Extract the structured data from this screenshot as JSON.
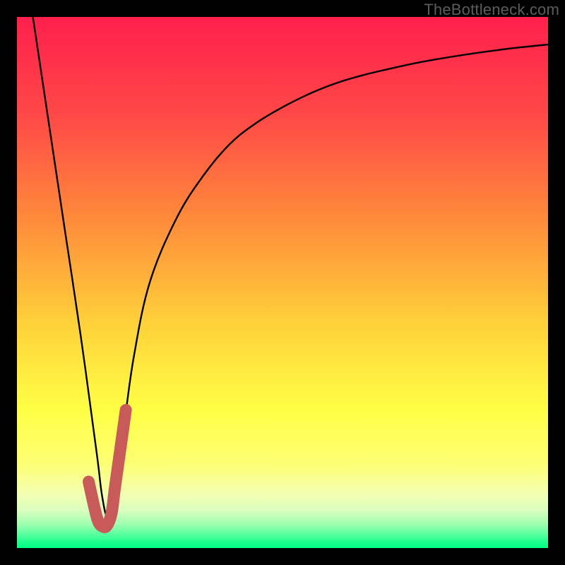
{
  "watermark": "TheBottleneck.com",
  "chart_data": {
    "type": "line",
    "title": "",
    "xlabel": "",
    "ylabel": "",
    "xlim": [
      0,
      100
    ],
    "ylim": [
      0,
      100
    ],
    "grid": false,
    "legend": false,
    "series": [
      {
        "name": "bottleneck-curve",
        "color": "#000000",
        "x": [
          3,
          6,
          9,
          12,
          15,
          16,
          17,
          18,
          20,
          22,
          25,
          30,
          35,
          40,
          45,
          50,
          55,
          60,
          65,
          70,
          75,
          80,
          85,
          90,
          95,
          100
        ],
        "y": [
          100,
          80,
          60,
          40,
          18,
          10,
          6,
          10,
          22,
          36,
          50,
          62,
          70,
          76,
          80,
          83,
          85.5,
          87.5,
          89,
          90.2,
          91.3,
          92.2,
          93,
          93.7,
          94.3,
          94.8
        ]
      },
      {
        "name": "highlight-segment",
        "color": "#c85a5a",
        "x": [
          13.5,
          14.5,
          15.3,
          16.2,
          17.0,
          17.8,
          18.4,
          19.1,
          19.8,
          20.5
        ],
        "y": [
          12.5,
          8.0,
          5.0,
          4.0,
          4.3,
          6.5,
          11,
          16,
          21,
          26
        ]
      }
    ],
    "background_gradient": {
      "direction": "vertical",
      "stops": [
        {
          "offset": 0.0,
          "color": "#ff1f4c"
        },
        {
          "offset": 0.18,
          "color": "#ff4747"
        },
        {
          "offset": 0.38,
          "color": "#ff8a3a"
        },
        {
          "offset": 0.58,
          "color": "#ffd23a"
        },
        {
          "offset": 0.74,
          "color": "#ffff45"
        },
        {
          "offset": 0.84,
          "color": "#fdff72"
        },
        {
          "offset": 0.9,
          "color": "#f3ffb3"
        },
        {
          "offset": 0.93,
          "color": "#d9ffbf"
        },
        {
          "offset": 0.955,
          "color": "#9fffb0"
        },
        {
          "offset": 0.975,
          "color": "#55ff9d"
        },
        {
          "offset": 0.99,
          "color": "#18ff8c"
        },
        {
          "offset": 1.0,
          "color": "#00ff84"
        }
      ]
    }
  }
}
